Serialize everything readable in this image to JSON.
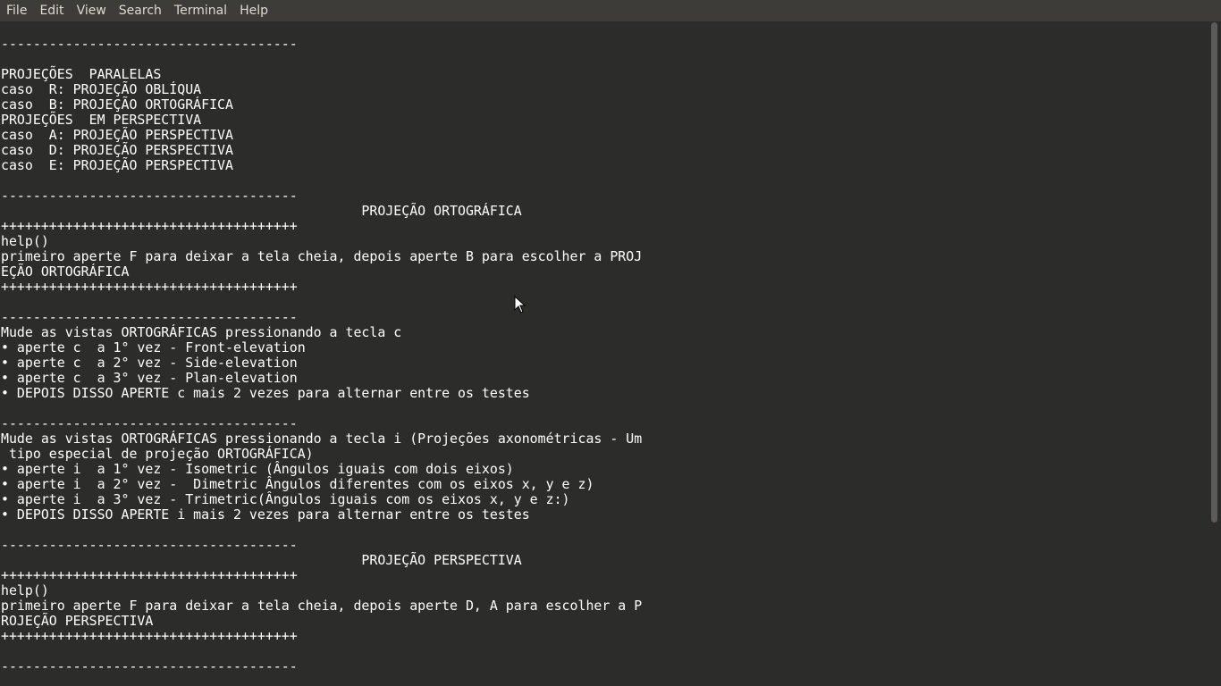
{
  "menubar": {
    "items": [
      "File",
      "Edit",
      "View",
      "Search",
      "Terminal",
      "Help"
    ]
  },
  "terminal": {
    "lines": [
      "-------------------------------------",
      "",
      "PROJEÇÕES  PARALELAS",
      "caso  R: PROJEÇÃO OBLÍQUA",
      "caso  B: PROJEÇÃO ORTOGRÁFICA",
      "PROJEÇÕES  EM PERSPECTIVA",
      "caso  A: PROJEÇÃO PERSPECTIVA",
      "caso  D: PROJEÇÃO PERSPECTIVA",
      "caso  E: PROJEÇÃO PERSPECTIVA",
      "",
      "-------------------------------------",
      "                                             PROJEÇÃO ORTOGRÁFICA",
      "+++++++++++++++++++++++++++++++++++++",
      "help()",
      "primeiro aperte F para deixar a tela cheia, depois aperte B para escolher a PROJ",
      "EÇÃO ORTOGRÁFICA",
      "+++++++++++++++++++++++++++++++++++++",
      "",
      "-------------------------------------",
      "Mude as vistas ORTOGRÁFICAS pressionando a tecla c",
      "• aperte c  a 1° vez - Front-elevation",
      "• aperte c  a 2° vez - Side-elevation",
      "• aperte c  a 3° vez - Plan-elevation",
      "• DEPOIS DISSO APERTE c mais 2 vezes para alternar entre os testes",
      "",
      "-------------------------------------",
      "Mude as vistas ORTOGRÁFICAS pressionando a tecla i (Projeções axonométricas - Um",
      " tipo especial de projeção ORTOGRÁFICA)",
      "• aperte i  a 1° vez - Isometric (Ângulos iguais com dois eixos)",
      "• aperte i  a 2° vez -  Dimetric Ângulos diferentes com os eixos x, y e z)",
      "• aperte i  a 3° vez - Trimetric(Ângulos iguais com os eixos x, y e z:)",
      "• DEPOIS DISSO APERTE i mais 2 vezes para alternar entre os testes",
      "",
      "-------------------------------------",
      "                                             PROJEÇÃO PERSPECTIVA",
      "+++++++++++++++++++++++++++++++++++++",
      "help()",
      "primeiro aperte F para deixar a tela cheia, depois aperte D, A para escolher a P",
      "ROJEÇÃO PERSPECTIVA",
      "+++++++++++++++++++++++++++++++++++++",
      "",
      "-------------------------------------"
    ]
  }
}
